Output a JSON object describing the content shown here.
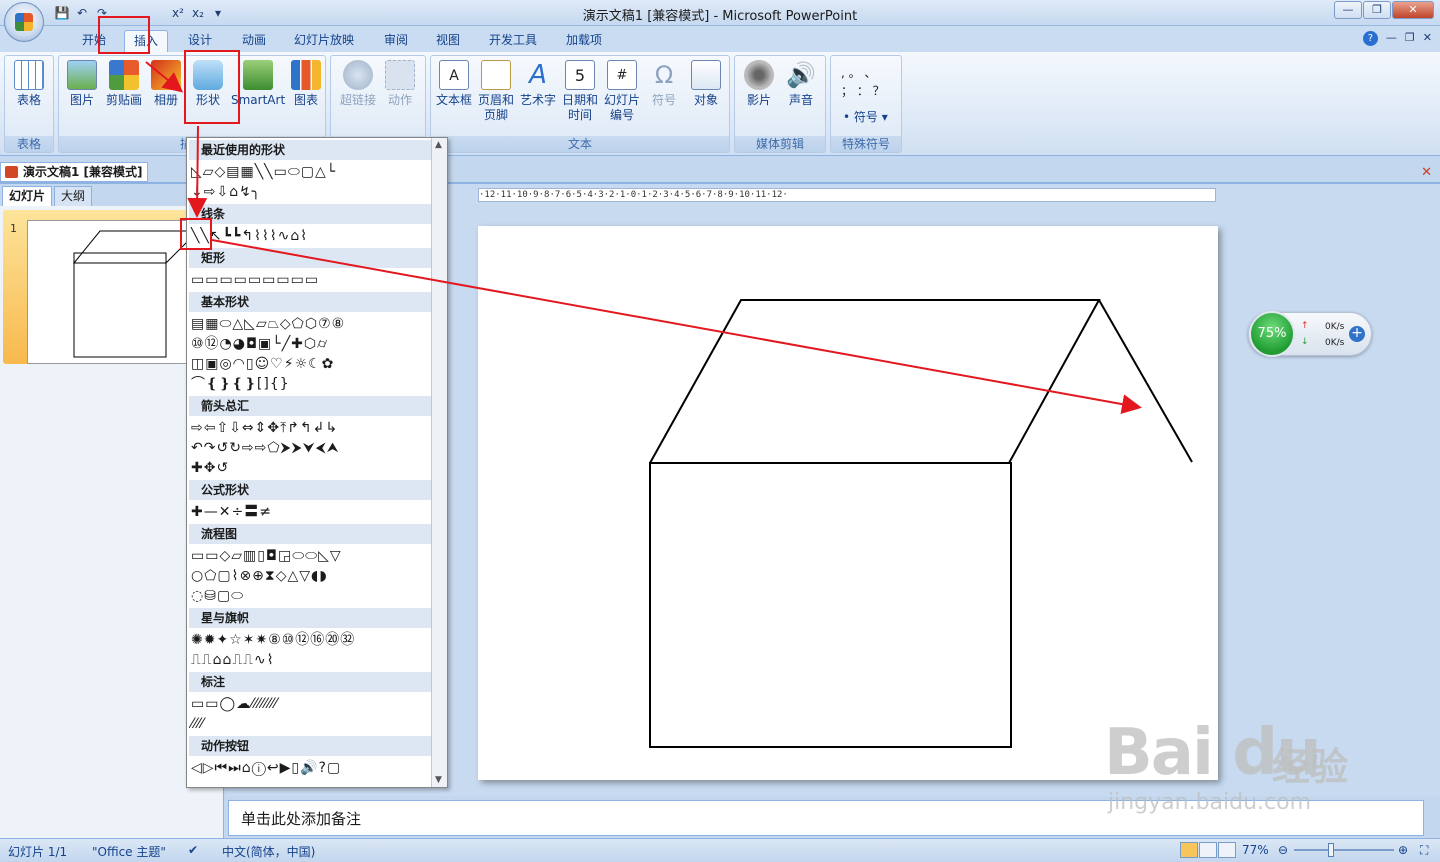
{
  "window": {
    "title": "演示文稿1 [兼容模式] - Microsoft PowerPoint",
    "qat": [
      "💾",
      "↶",
      "↷",
      "x²",
      "x₂",
      "▾"
    ],
    "controls": [
      "—",
      "❐",
      "✕"
    ]
  },
  "ribbon_tabs": [
    "开始",
    "插入",
    "设计",
    "动画",
    "幻灯片放映",
    "审阅",
    "视图",
    "开发工具",
    "加载项"
  ],
  "active_tab": "插入",
  "help_icons": [
    "?",
    "—",
    "❐",
    "✕"
  ],
  "groups": {
    "tables": {
      "label": "表格",
      "buttons": [
        "表格"
      ]
    },
    "illustrations": {
      "label": "插图",
      "buttons": [
        "图片",
        "剪贴画",
        "相册",
        "形状",
        "SmartArt",
        "图表"
      ]
    },
    "links": {
      "label": "链接",
      "buttons": [
        "超链接",
        "动作"
      ]
    },
    "text": {
      "label": "文本",
      "buttons": [
        "文本框",
        "页眉和页脚",
        "艺术字",
        "日期和时间",
        "幻灯片编号",
        "符号",
        "对象"
      ]
    },
    "media": {
      "label": "媒体剪辑",
      "buttons": [
        "影片",
        "声音"
      ]
    },
    "special": {
      "label": "特殊符号",
      "button": "符号",
      "chars": ", 。 、 ； ： ？"
    }
  },
  "document_tab": "演示文稿1 [兼容模式]",
  "panel_tabs": [
    "幻灯片",
    "大纲"
  ],
  "slide_number": "1",
  "ruler_text": "·12·11·10·9·8·7·6·5·4·3·2·1·0·1·2·3·4·5·6·7·8·9·10·11·12·",
  "notes_placeholder": "单击此处添加备注",
  "status": {
    "slide": "幻灯片 1/1",
    "theme": "\"Office 主题\"",
    "language": "中文(简体，中国)",
    "zoom": "77%"
  },
  "netmeter": {
    "percent": "75%",
    "up_arrow": "↑",
    "down_arrow": "↓",
    "up": "0K/s",
    "down": "0K/s",
    "plus": "+"
  },
  "shapes_dropdown": {
    "sections": [
      {
        "title": "最近使用的形状",
        "rows": [
          "◺▱◇▤▦╲╲▭⬭▢△└",
          "↓⇨⇩⌂↯╮"
        ]
      },
      {
        "title": "线条",
        "rows": [
          "╲╲↖┗┗↰⌇⌇⌇∿⌂⌇"
        ]
      },
      {
        "title": "矩形",
        "rows": [
          "▭▭▭▭▭▭▭▭▭"
        ]
      },
      {
        "title": "基本形状",
        "rows": [
          "▤▦⬭△◺▱⏢◇⬠⬡⑦⑧",
          "⑩⑫◔◕◘▣└╱✚⬡⌭",
          "◫▣◎◠▯☺♡⚡☼☾✿",
          "⌒❴❵❴❵[]{}"
        ]
      },
      {
        "title": "箭头总汇",
        "rows": [
          "⇨⇦⇧⇩⇔⇕✥⤒↱↰↲↳",
          "↶↷↺↻⇨⇨⬠⮞⮞⮟⮜⮝",
          "✚✥↺"
        ]
      },
      {
        "title": "公式形状",
        "rows": [
          "✚—✕÷〓≠"
        ]
      },
      {
        "title": "流程图",
        "rows": [
          "▭▭◇▱▥▯◘◲⬭⬭◺▽",
          "○⬠▢⌇⊗⊕⧗◇△▽◖◗",
          "◌⛁▢⬭"
        ]
      },
      {
        "title": "星与旗帜",
        "rows": [
          "✺✹✦☆✶✷⑧⑩⑫⑯⑳㉜",
          "⎍⎍⌂⌂⎍⎍∿⌇"
        ]
      },
      {
        "title": "标注",
        "rows": [
          "▭▭◯☁⁄⁄⁄⁄⁄⁄⁄⁄",
          "⁄⁄⁄⁄"
        ]
      },
      {
        "title": "动作按钮",
        "rows": [
          "◁▷⏮⏭⌂ⓘ↩▶▯🔊?▢"
        ]
      }
    ]
  }
}
